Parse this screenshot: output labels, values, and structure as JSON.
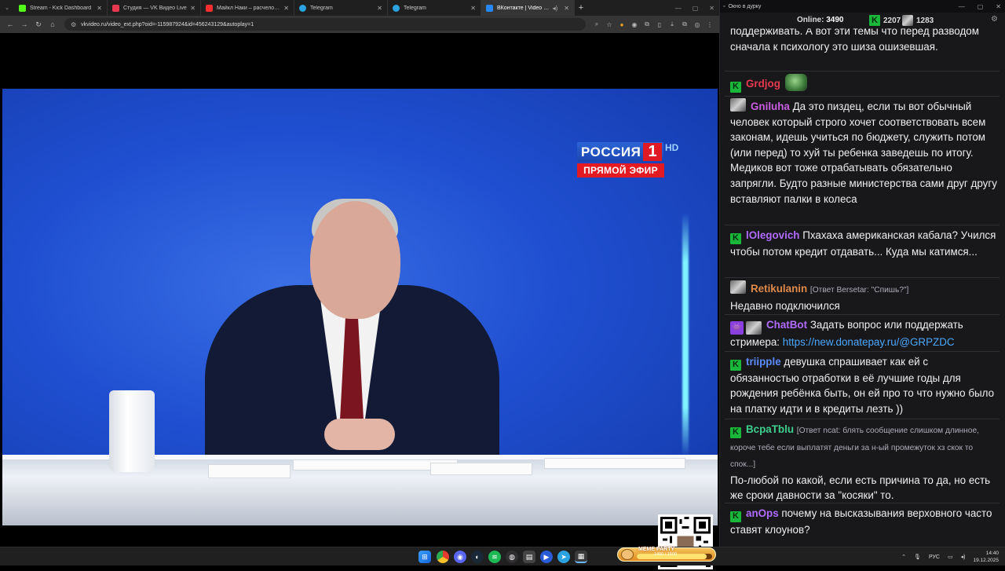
{
  "browser": {
    "tabs": [
      {
        "label": "Stream - Kick Dashboard",
        "color": "#53fc18"
      },
      {
        "label": "Студия — VK Видео Live",
        "color": "#e8384f"
      },
      {
        "label": "Майкл Наки – расчеловечива...",
        "color": "#ff2d2d"
      },
      {
        "label": "Telegram",
        "color": "#2aa3e0"
      },
      {
        "label": "Telegram",
        "color": "#2aa3e0"
      },
      {
        "label": "ВКонтакте | Video Ext",
        "color": "#2787f5"
      }
    ],
    "url": "vkvideo.ru/video_ext.php?oid=-115987924&id=456243129&autoplay=1"
  },
  "tv": {
    "channel": "РОССИЯ",
    "channel_num": "1",
    "hd": "HD",
    "live": "ПРЯМОЙ ЭФИР"
  },
  "chat": {
    "window_title": "Окно в дурку",
    "online_label": "Online:",
    "online_count": "3490",
    "kick_count": "2207",
    "other_count": "1283",
    "messages": [
      {
        "text": "поддерживать. А вот эти темы что перед разводом сначала к психологу это шиза ошизевшая."
      },
      {
        "user": "Grdjog",
        "color": "#e8384f"
      },
      {
        "user": "Gniluha",
        "color": "#c85fe0",
        "text": "Да это пиздец, если ты вот обычный человек который строго хочет соответствовать всем законам, идешь учиться по бюджету, служить потом (или перед) то хуй ты ребенка заведешь по итогу. Медиков вот тоже отрабатывать обязательно запрягли. Будто разные министерства сами друг другу вставляют палки в колеса"
      },
      {
        "user": "lOlegovich",
        "color": "#b06bff",
        "text": "Пхахаха американская кабала? Учился чтобы потом кредит отдавать... Куда мы катимся..."
      },
      {
        "user": "Retikulanin",
        "color": "#e08a4a",
        "reply": "[Ответ Bersetar: \"Спишь?\"]",
        "text": "Недавно подключился"
      },
      {
        "user": "ChatBot",
        "color": "#b06bff",
        "text": "Задать вопрос или поддержать стримера:",
        "link": "https://new.donatepay.ru/@GRPZDC"
      },
      {
        "user": "triipple",
        "color": "#5b8cff",
        "text": "девушка спрашивает как ей с обязанностью отработки в её лучшие годы для рождения ребёнка быть, он ей про то что нужно было на платку идти и в кредиты лезть ))"
      },
      {
        "user": "BcpaTblu",
        "color": "#3ecf8e",
        "reply": "[Ответ ncat: блять сообщение слишком длинное, короче тебе если выплатят деньги за н-ый промежуток хз скок то спок...]",
        "text": "По-любой по какой, если есть причина то да, но есть же сроки давности за \"косяки\" то."
      },
      {
        "user": "anOps",
        "color": "#b06bff",
        "text": "почему на высказывания верховного часто ставят клоунов?"
      }
    ]
  },
  "taskbar": {
    "meme_title": "MEME PARTY",
    "meme_progress": "1400 / 1500",
    "meme_fraction": 0.93,
    "lang": "РУС",
    "time": "14:40",
    "date": "19.12.2025"
  }
}
